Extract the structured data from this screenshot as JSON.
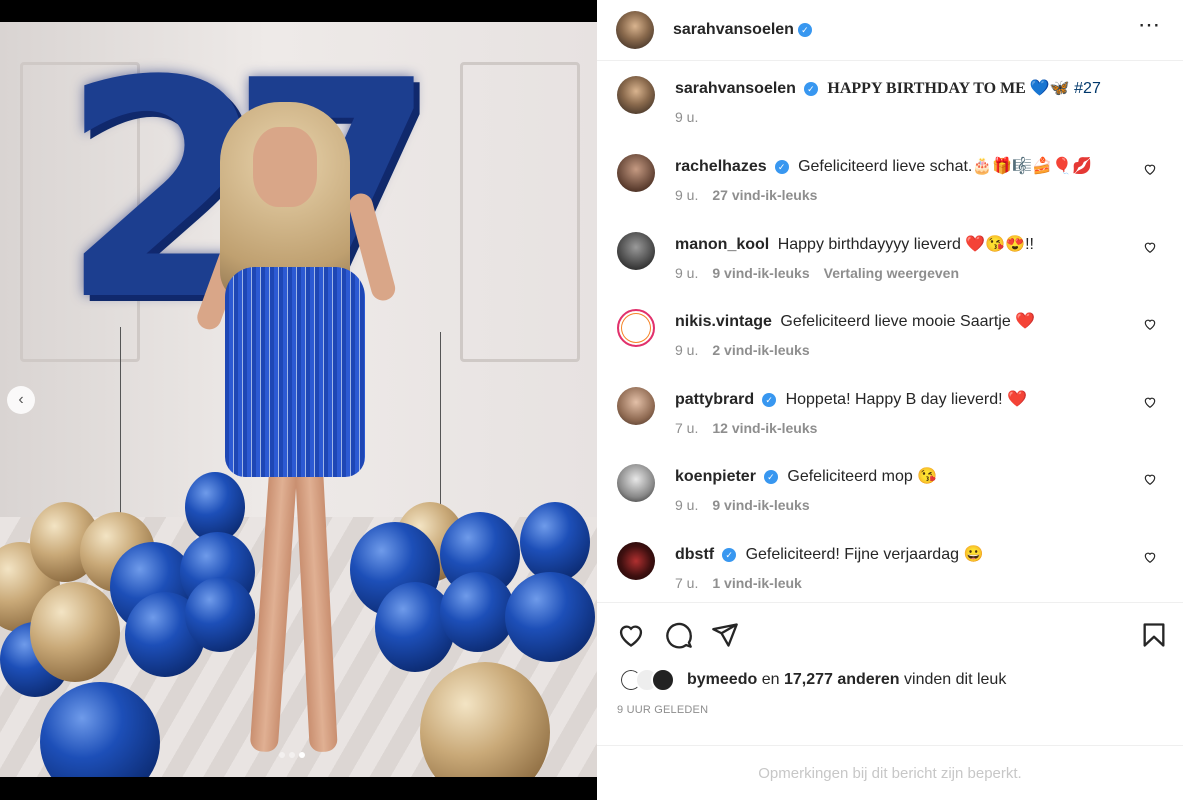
{
  "post": {
    "author": "sarahvansoelen",
    "caption_text": "HAPPY BIRTHDAY TO ME 💙🦋",
    "caption_hashtag": "#27",
    "caption_time": "9 u.",
    "more_icon": "more-horizontal-icon"
  },
  "photo": {
    "balloon_number": "27",
    "carousel_total": 3,
    "carousel_active": 3
  },
  "comments": [
    {
      "user": "rachelhazes",
      "verified": true,
      "text": "Gefeliciteerd lieve schat.🎂🎁🎼🍰🎈💋",
      "time": "9 u.",
      "likes": "27 vind-ik-leuks",
      "extra": ""
    },
    {
      "user": "manon_kool",
      "verified": false,
      "text": "Happy birthdayyyy lieverd ❤️😘😍!!",
      "time": "9 u.",
      "likes": "9 vind-ik-leuks",
      "extra": "Vertaling weergeven"
    },
    {
      "user": "nikis.vintage",
      "verified": false,
      "text": "Gefeliciteerd lieve mooie Saartje ❤️",
      "time": "9 u.",
      "likes": "2 vind-ik-leuks",
      "extra": ""
    },
    {
      "user": "pattybrard",
      "verified": true,
      "text": "Hoppeta! Happy B day lieverd! ❤️",
      "time": "7 u.",
      "likes": "12 vind-ik-leuks",
      "extra": ""
    },
    {
      "user": "koenpieter",
      "verified": true,
      "text": "Gefeliciteerd mop 😘",
      "time": "9 u.",
      "likes": "9 vind-ik-leuks",
      "extra": ""
    },
    {
      "user": "dbstf",
      "verified": true,
      "text": "Gefeliciteerd! Fijne verjaardag 😀",
      "time": "7 u.",
      "likes": "1 vind-ik-leuk",
      "extra": ""
    }
  ],
  "likes": {
    "first_user": "bymeedo",
    "joiner": "en",
    "others": "17,277 anderen",
    "suffix": "vinden dit leuk"
  },
  "timestamp": "9 UUR GELEDEN",
  "comments_limited": "Opmerkingen bij dit bericht zijn beperkt.",
  "colors": {
    "verified": "#3897f0",
    "hashtag": "#00376b",
    "secondary": "#8e8e8e"
  }
}
